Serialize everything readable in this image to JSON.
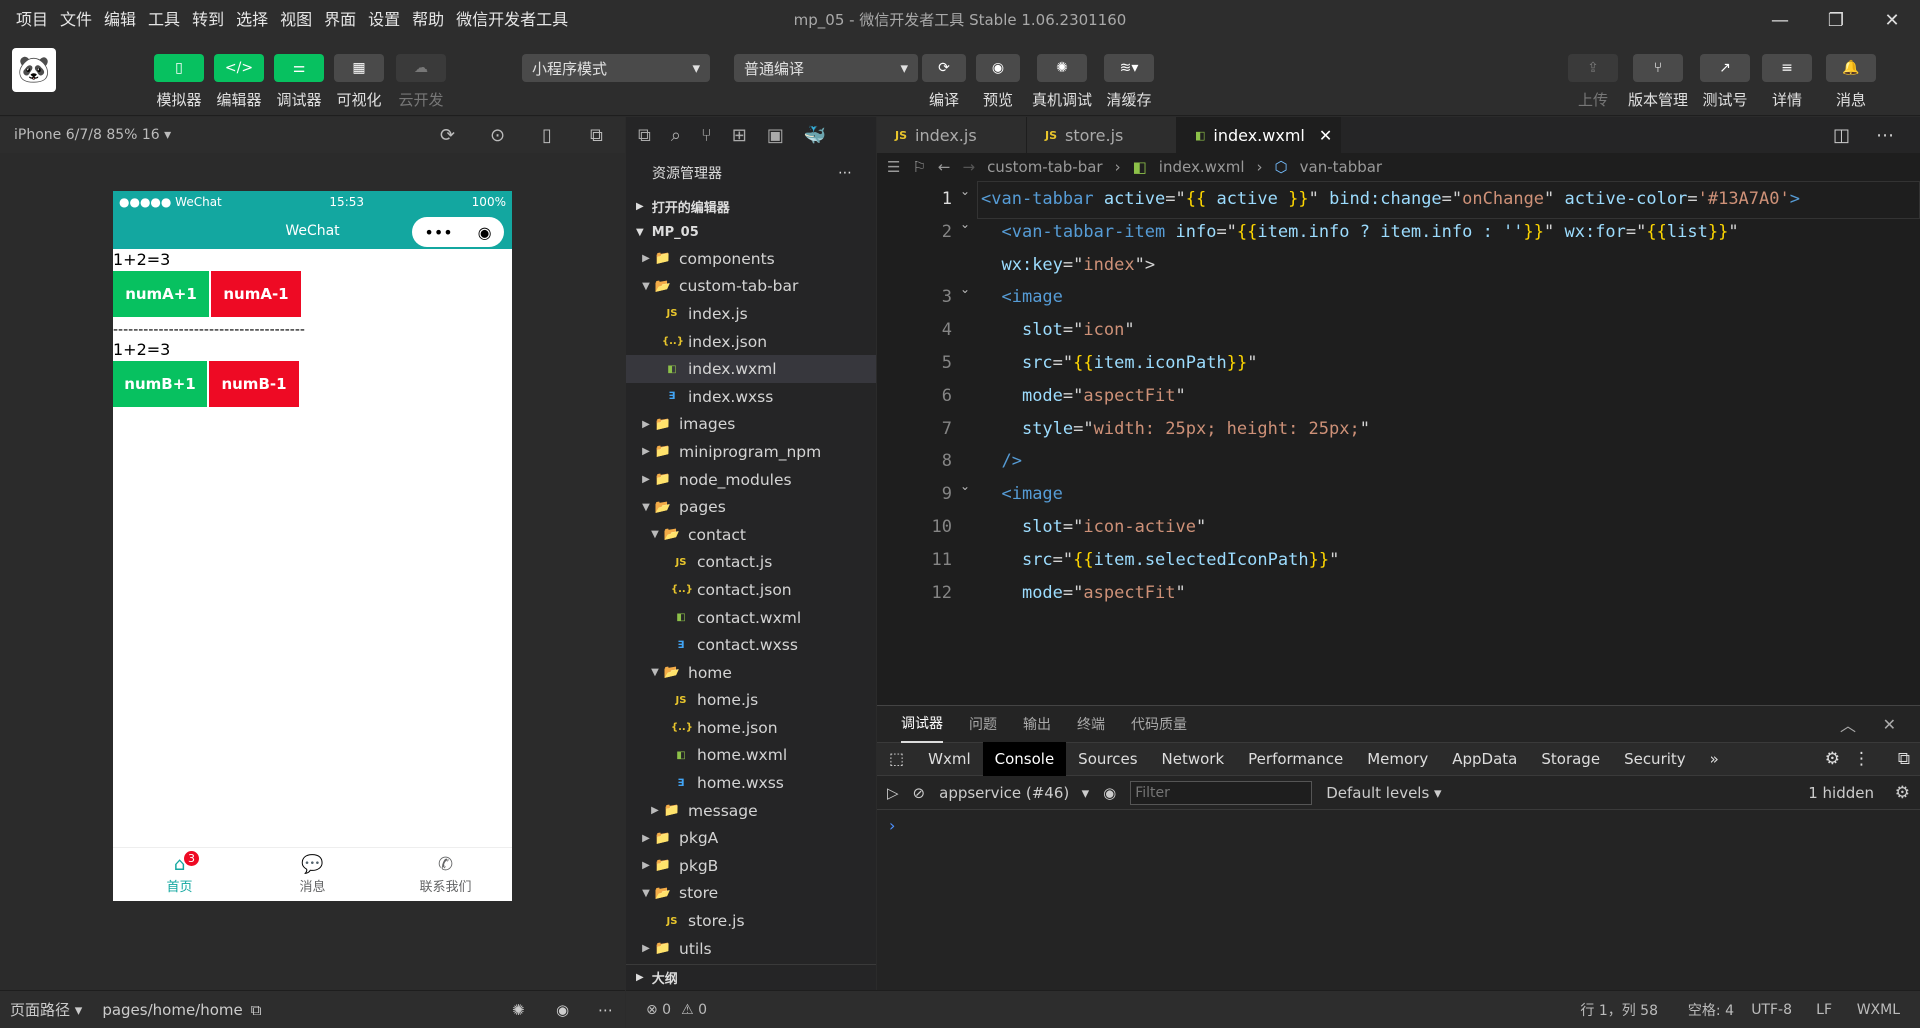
{
  "menu": [
    "项目",
    "文件",
    "编辑",
    "工具",
    "转到",
    "选择",
    "视图",
    "界面",
    "设置",
    "帮助",
    "微信开发者工具"
  ],
  "window_title": "mp_05 - 微信开发者工具 Stable 1.06.2301160",
  "toolbar": {
    "simulator": "模拟器",
    "editor": "编辑器",
    "debugger": "调试器",
    "visual": "可视化",
    "cloud": "云开发",
    "mode": "小程序模式",
    "compile_mode": "普通编译",
    "compile": "编译",
    "preview": "预览",
    "real_debug": "真机调试",
    "clear_cache": "清缓存",
    "upload": "上传",
    "version": "版本管理",
    "test": "测试号",
    "details": "详情",
    "messages": "消息"
  },
  "sim": {
    "device": "iPhone 6/7/8 85% 16 ▾",
    "carrier": "●●●●● WeChat",
    "time": "15:53",
    "battery": "100%",
    "nav_title": "WeChat",
    "eq1": "1+2=3",
    "btnA1": "numA+1",
    "btnA2": "numA-1",
    "dashes": "--------------------------------------",
    "eq2": "1+2=3",
    "btnB1": "numB+1",
    "btnB2": "numB-1",
    "tabs": [
      "首页",
      "消息",
      "联系我们"
    ],
    "badge": "3"
  },
  "bottom_left": {
    "path_label": "页面路径 ▾",
    "path": "pages/home/home"
  },
  "explorer": {
    "title": "资源管理器",
    "open_editors": "打开的编辑器",
    "project": "MP_05",
    "outline": "大纲",
    "tree": [
      {
        "name": "components",
        "indent": 1,
        "type": "folder",
        "open": false
      },
      {
        "name": "custom-tab-bar",
        "indent": 1,
        "type": "folder",
        "open": true
      },
      {
        "name": "index.js",
        "indent": 2,
        "type": "js"
      },
      {
        "name": "index.json",
        "indent": 2,
        "type": "json"
      },
      {
        "name": "index.wxml",
        "indent": 2,
        "type": "wxml",
        "selected": true
      },
      {
        "name": "index.wxss",
        "indent": 2,
        "type": "wxss"
      },
      {
        "name": "images",
        "indent": 1,
        "type": "folder",
        "open": false
      },
      {
        "name": "miniprogram_npm",
        "indent": 1,
        "type": "folder",
        "open": false
      },
      {
        "name": "node_modules",
        "indent": 1,
        "type": "folder",
        "open": false
      },
      {
        "name": "pages",
        "indent": 1,
        "type": "folder",
        "open": true
      },
      {
        "name": "contact",
        "indent": 2,
        "type": "folder",
        "open": true
      },
      {
        "name": "contact.js",
        "indent": 3,
        "type": "js"
      },
      {
        "name": "contact.json",
        "indent": 3,
        "type": "json"
      },
      {
        "name": "contact.wxml",
        "indent": 3,
        "type": "wxml"
      },
      {
        "name": "contact.wxss",
        "indent": 3,
        "type": "wxss"
      },
      {
        "name": "home",
        "indent": 2,
        "type": "folder",
        "open": true
      },
      {
        "name": "home.js",
        "indent": 3,
        "type": "js"
      },
      {
        "name": "home.json",
        "indent": 3,
        "type": "json"
      },
      {
        "name": "home.wxml",
        "indent": 3,
        "type": "wxml"
      },
      {
        "name": "home.wxss",
        "indent": 3,
        "type": "wxss"
      },
      {
        "name": "message",
        "indent": 2,
        "type": "folder",
        "open": false
      },
      {
        "name": "pkgA",
        "indent": 1,
        "type": "folder",
        "open": false
      },
      {
        "name": "pkgB",
        "indent": 1,
        "type": "folder",
        "open": false
      },
      {
        "name": "store",
        "indent": 1,
        "type": "folder",
        "open": true
      },
      {
        "name": "store.js",
        "indent": 2,
        "type": "js"
      },
      {
        "name": "utils",
        "indent": 1,
        "type": "folder",
        "open": false
      }
    ]
  },
  "editor_tabs": [
    {
      "name": "index.js",
      "type": "js"
    },
    {
      "name": "store.js",
      "type": "js"
    },
    {
      "name": "index.wxml",
      "type": "wxml",
      "active": true
    }
  ],
  "breadcrumb": [
    "custom-tab-bar",
    "index.wxml",
    "van-tabbar"
  ],
  "code_lines": [
    [
      [
        "tg",
        "<van-tabbar "
      ],
      [
        "at",
        "active"
      ],
      [
        "pu",
        "=\""
      ],
      [
        "yl",
        "{{"
      ],
      [
        "at",
        " active "
      ],
      [
        "yl",
        "}}"
      ],
      [
        "pu",
        "\" "
      ],
      [
        "at",
        "bind:change"
      ],
      [
        "pu",
        "=\""
      ],
      [
        "st",
        "onChange"
      ],
      [
        "pu",
        "\" "
      ],
      [
        "at",
        "active-color"
      ],
      [
        "pu",
        "="
      ],
      [
        "st",
        "'#13A7A0'"
      ],
      [
        "tg",
        ">"
      ]
    ],
    [
      [
        "pu",
        "  "
      ],
      [
        "tg",
        "<van-tabbar-item "
      ],
      [
        "at",
        "info"
      ],
      [
        "pu",
        "=\""
      ],
      [
        "yl",
        "{{"
      ],
      [
        "at",
        "item.info ? item.info : ''"
      ],
      [
        "yl",
        "}}"
      ],
      [
        "pu",
        "\" "
      ],
      [
        "at",
        "wx:for"
      ],
      [
        "pu",
        "=\""
      ],
      [
        "yl",
        "{{"
      ],
      [
        "at",
        "list"
      ],
      [
        "yl",
        "}}"
      ],
      [
        "pu",
        "\""
      ]
    ],
    [
      [
        "pu",
        "  "
      ],
      [
        "at",
        "wx:key"
      ],
      [
        "pu",
        "=\""
      ],
      [
        "st",
        "index"
      ],
      [
        "pu",
        "\">"
      ]
    ],
    [
      [
        "pu",
        "  "
      ],
      [
        "tg",
        "<image"
      ]
    ],
    [
      [
        "pu",
        "    "
      ],
      [
        "at",
        "slot"
      ],
      [
        "pu",
        "=\""
      ],
      [
        "st",
        "icon"
      ],
      [
        "pu",
        "\""
      ]
    ],
    [
      [
        "pu",
        "    "
      ],
      [
        "at",
        "src"
      ],
      [
        "pu",
        "=\""
      ],
      [
        "yl",
        "{{"
      ],
      [
        "at",
        "item.iconPath"
      ],
      [
        "yl",
        "}}"
      ],
      [
        "pu",
        "\""
      ]
    ],
    [
      [
        "pu",
        "    "
      ],
      [
        "at",
        "mode"
      ],
      [
        "pu",
        "=\""
      ],
      [
        "st",
        "aspectFit"
      ],
      [
        "pu",
        "\""
      ]
    ],
    [
      [
        "pu",
        "    "
      ],
      [
        "at",
        "style"
      ],
      [
        "pu",
        "=\""
      ],
      [
        "st",
        "width: 25px; height: 25px;"
      ],
      [
        "pu",
        "\""
      ]
    ],
    [
      [
        "pu",
        "  "
      ],
      [
        "tg",
        "/>"
      ]
    ],
    [
      [
        "pu",
        "  "
      ],
      [
        "tg",
        "<image"
      ]
    ],
    [
      [
        "pu",
        "    "
      ],
      [
        "at",
        "slot"
      ],
      [
        "pu",
        "=\""
      ],
      [
        "st",
        "icon-active"
      ],
      [
        "pu",
        "\""
      ]
    ],
    [
      [
        "pu",
        "    "
      ],
      [
        "at",
        "src"
      ],
      [
        "pu",
        "=\""
      ],
      [
        "yl",
        "{{"
      ],
      [
        "at",
        "item.selectedIconPath"
      ],
      [
        "yl",
        "}}"
      ],
      [
        "pu",
        "\""
      ]
    ],
    [
      [
        "pu",
        "    "
      ],
      [
        "at",
        "mode"
      ],
      [
        "pu",
        "=\""
      ],
      [
        "st",
        "aspectFit"
      ],
      [
        "pu",
        "\""
      ]
    ]
  ],
  "line_numbers": [
    "1",
    "2",
    "",
    "3",
    "4",
    "5",
    "6",
    "7",
    "8",
    "9",
    "10",
    "11",
    "12"
  ],
  "panel": {
    "tabs": [
      "调试器",
      "问题",
      "输出",
      "终端",
      "代码质量"
    ],
    "devtabs": [
      "Wxml",
      "Console",
      "Sources",
      "Network",
      "Performance",
      "Memory",
      "AppData",
      "Storage",
      "Security",
      "»"
    ],
    "context": "appservice (#46)",
    "filter_placeholder": "Filter",
    "levels": "Default levels ▾",
    "hidden": "1 hidden",
    "prompt": "›"
  },
  "statusbar": {
    "errors": "⊗ 0",
    "warnings": "⚠ 0",
    "position": "行 1，列 58",
    "spaces": "空格: 4",
    "encoding": "UTF-8",
    "eol": "LF",
    "lang": "WXML"
  }
}
